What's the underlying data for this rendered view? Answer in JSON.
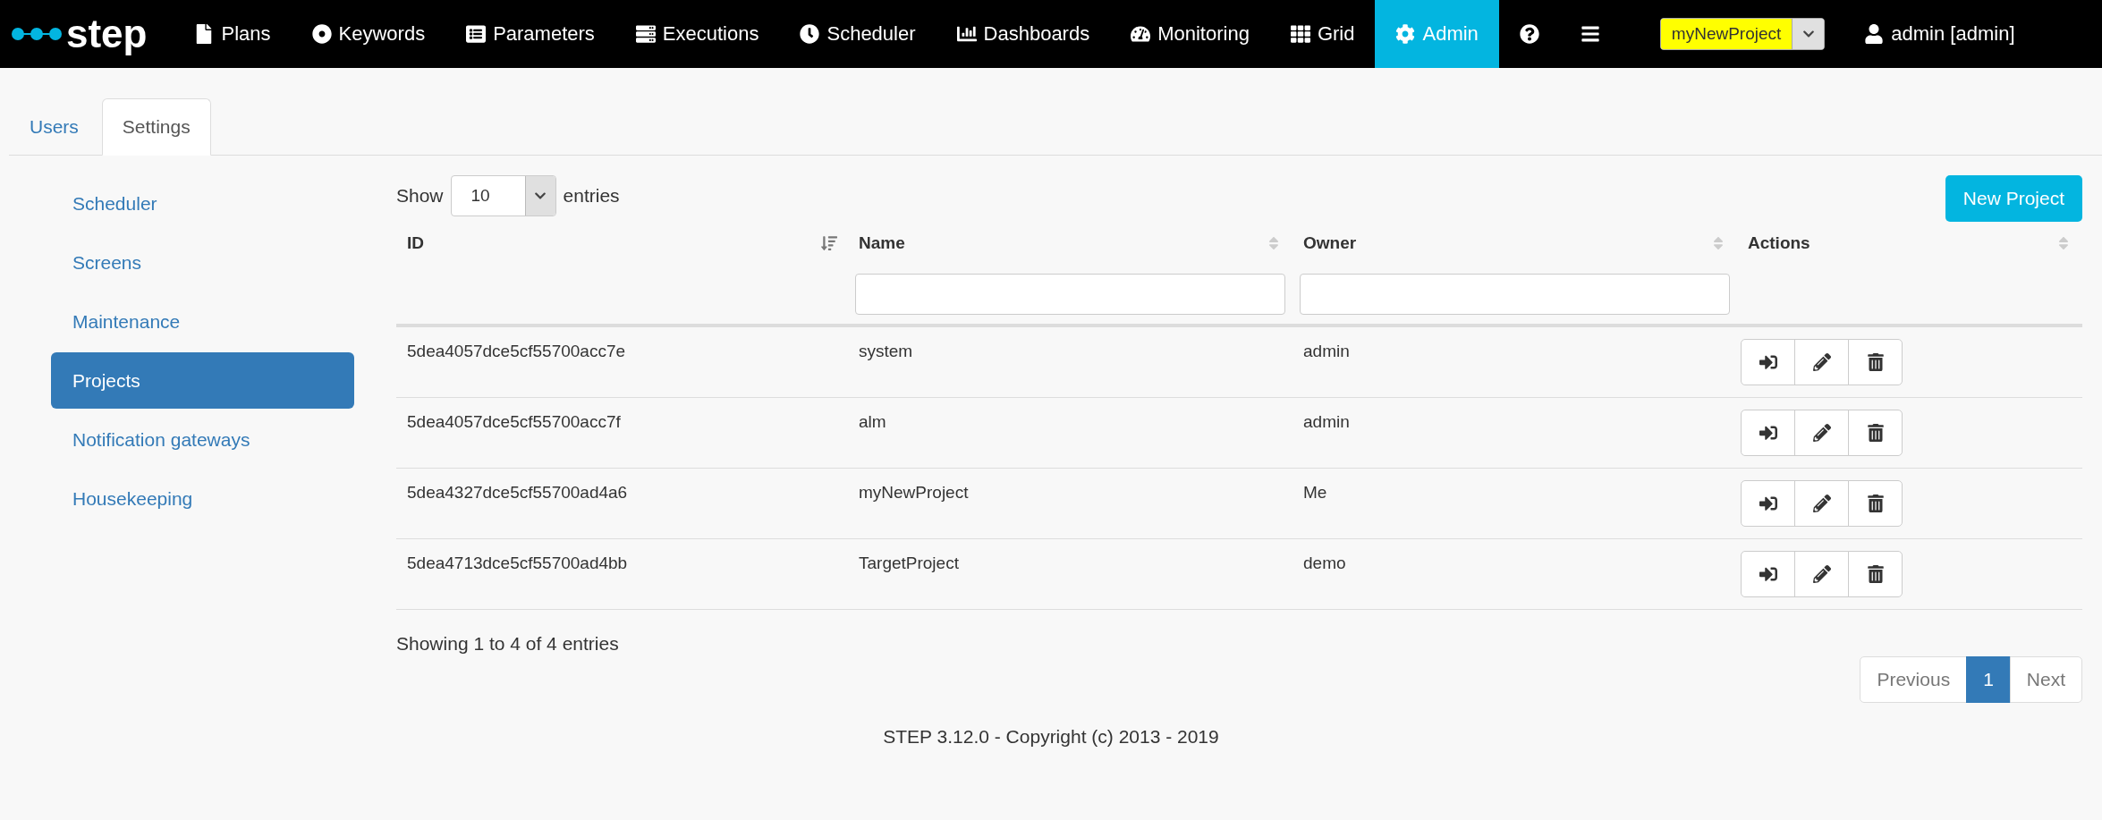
{
  "navbar": {
    "logo": "step",
    "items": [
      {
        "label": "Plans",
        "selected": false
      },
      {
        "label": "Keywords",
        "selected": false
      },
      {
        "label": "Parameters",
        "selected": false
      },
      {
        "label": "Executions",
        "selected": false
      },
      {
        "label": "Scheduler",
        "selected": false
      },
      {
        "label": "Dashboards",
        "selected": false
      },
      {
        "label": "Monitoring",
        "selected": false
      },
      {
        "label": "Grid",
        "selected": false
      },
      {
        "label": "Admin",
        "selected": true
      }
    ],
    "project_select": {
      "value": "myNewProject",
      "highlighted": true
    },
    "user": "admin [admin]"
  },
  "tabs": [
    {
      "label": "Users",
      "selected": false
    },
    {
      "label": "Settings",
      "selected": true
    }
  ],
  "sidebar": {
    "items": [
      {
        "label": "Scheduler",
        "selected": false
      },
      {
        "label": "Screens",
        "selected": false
      },
      {
        "label": "Maintenance",
        "selected": false
      },
      {
        "label": "Projects",
        "selected": true
      },
      {
        "label": "Notification gateways",
        "selected": false
      },
      {
        "label": "Housekeeping",
        "selected": false
      }
    ]
  },
  "length_control": {
    "before": "Show",
    "value": "10",
    "after": "entries"
  },
  "new_project_button": "New Project",
  "table": {
    "columns": [
      {
        "label": "ID",
        "sorted": true,
        "filter": false
      },
      {
        "label": "Name",
        "sorted": false,
        "filter": true
      },
      {
        "label": "Owner",
        "sorted": false,
        "filter": true
      },
      {
        "label": "Actions",
        "sorted": false,
        "filter": false
      }
    ],
    "rows": [
      {
        "id": "5dea4057dce5cf55700acc7e",
        "name": "system",
        "owner": "admin"
      },
      {
        "id": "5dea4057dce5cf55700acc7f",
        "name": "alm",
        "owner": "admin"
      },
      {
        "id": "5dea4327dce5cf55700ad4a6",
        "name": "myNewProject",
        "owner": "Me"
      },
      {
        "id": "5dea4713dce5cf55700ad4bb",
        "name": "TargetProject",
        "owner": "demo"
      }
    ]
  },
  "info": "Showing 1 to 4 of 4 entries",
  "pagination": {
    "previous": "Previous",
    "pages": [
      {
        "label": "1",
        "selected": true
      }
    ],
    "next": "Next"
  },
  "footer": "STEP 3.12.0 - Copyright (c) 2013 - 2019"
}
